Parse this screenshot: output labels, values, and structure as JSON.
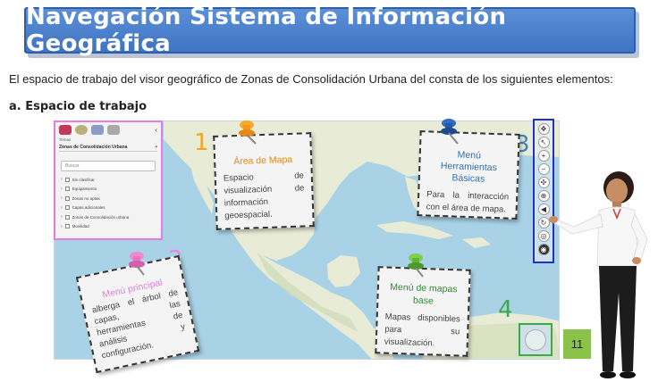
{
  "header": {
    "title": "Navegación Sistema de Información Geográfica"
  },
  "intro": "El espacio de trabajo del visor geográfico de Zonas de Consolidación Urbana del consta de los siguientes elementos:",
  "section_title": "a. Espacio de trabajo",
  "sidebar": {
    "small_label": "Temas",
    "selected_theme": "Zonas de Consolidación Urbana",
    "search_placeholder": "Buscar",
    "collapse_glyph": "‹",
    "layers": [
      "Sin clasificar",
      "Equipamiento",
      "Zonas no aptas",
      "Capas adicionales",
      "Zonas de Consolidación urbana",
      "Movilidad"
    ]
  },
  "numbers": {
    "n1": "1",
    "n2": "2",
    "n3": "3",
    "n4": "4"
  },
  "notes": {
    "mapa": {
      "title": "Área de Mapa",
      "body": "Espacio de visualización de información geoespacial."
    },
    "herramientas": {
      "title": "Menú Herramientas Básicas",
      "body": "Para la interacción con el área de mapa."
    },
    "menu": {
      "title": "Menú principal",
      "body": "alberga el árbol de capas, las herramientas de análisis y configuración."
    },
    "base": {
      "title": "Menú de mapas base",
      "body": "Mapas disponibles para su visualización."
    }
  },
  "toolbar": {
    "tools": [
      {
        "icon": "compass-icon",
        "glyph": "✥"
      },
      {
        "icon": "pointer-icon",
        "glyph": "↖"
      },
      {
        "icon": "zoom-in-icon",
        "glyph": "+"
      },
      {
        "icon": "zoom-out-icon",
        "glyph": "−"
      },
      {
        "icon": "full-extent-icon",
        "glyph": "✣"
      },
      {
        "icon": "zoom-box-icon",
        "glyph": "⊕"
      },
      {
        "icon": "previous-extent-icon",
        "glyph": "◀"
      },
      {
        "icon": "next-extent-icon",
        "glyph": "↻"
      },
      {
        "icon": "locate-icon",
        "glyph": "◎"
      },
      {
        "icon": "layers-toggle-icon",
        "glyph": "◉"
      }
    ]
  },
  "page_number": "11",
  "colors": {
    "banner": "#4a80cc",
    "sidebar_border": "#e87be0",
    "toolbar_border": "#2233bb",
    "basemap_border": "#3daa4a",
    "ocean": "#a9d2e6",
    "land": "#e8ecd6",
    "page_badge": "#8bc34a"
  }
}
